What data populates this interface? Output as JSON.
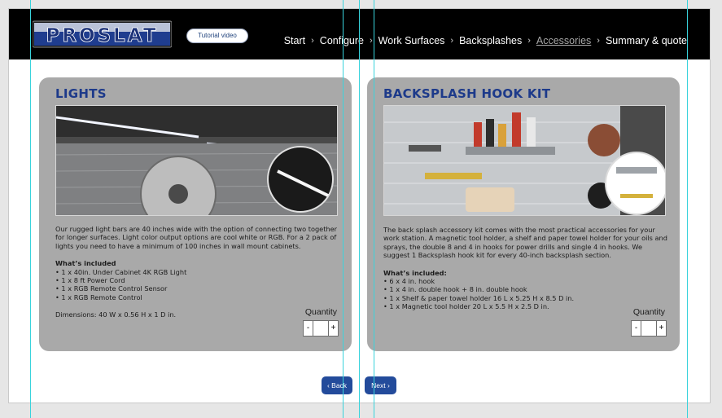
{
  "header": {
    "logo_text": "PROSLAT",
    "tutorial_label": "Tutorial video",
    "nav": [
      {
        "label": "Start",
        "active": false
      },
      {
        "label": "Configure",
        "active": false
      },
      {
        "label": "Work Surfaces",
        "active": false
      },
      {
        "label": "Backsplashes",
        "active": false
      },
      {
        "label": "Accessories",
        "active": true
      },
      {
        "label": "Summary & quote",
        "active": false
      }
    ]
  },
  "cards": [
    {
      "title": "LIGHTS",
      "description": "Our rugged light bars are 40 inches wide with the option of connecting two together for longer surfaces. Light color output options are cool white or RGB. For a 2 pack of lights you need to have a minimum of 100 inches in wall mount cabinets.",
      "included_title": "What’s included",
      "included": [
        "• 1 x 40in. Under Cabinet 4K RGB Light",
        "• 1 x 8 ft Power Cord",
        "• 1 x RGB Remote Control Sensor",
        "• 1 x RGB Remote Control"
      ],
      "dimensions": "Dimensions: 40 W  x  0.56 H x 1 D in.",
      "quantity_label": "Quantity",
      "minus": "-",
      "plus": "+"
    },
    {
      "title": "BACKSPLASH HOOK KIT",
      "description": "The back splash accessory kit comes with the most practical accessories for your work station. A magnetic tool holder, a shelf and paper towel holder for your oils and sprays, the double 8 and 4 in hooks for power drills and single 4 in hooks. We suggest 1 Backsplash hook kit for every 40-inch backsplash section.",
      "included_title": "What’s included:",
      "included": [
        "• 6 x 4 in. hook",
        "• 1 x 4 in. double hook + 8 in. double hook",
        "• 1 x Shelf & paper towel holder 16 L x 5.25 H x 8.5 D in.",
        "• 1 x Magnetic tool holder 20 L x 5.5 H x 2.5 D in."
      ],
      "quantity_label": "Quantity",
      "minus": "-",
      "plus": "+"
    }
  ],
  "footer": {
    "back_label": "‹ Back",
    "next_label": "Next ›"
  },
  "colors": {
    "accent": "#1d3a8a",
    "button": "#234b9b",
    "card_bg": "#a9a9a9",
    "header_bg": "#000000",
    "guide": "#39d3dc"
  }
}
